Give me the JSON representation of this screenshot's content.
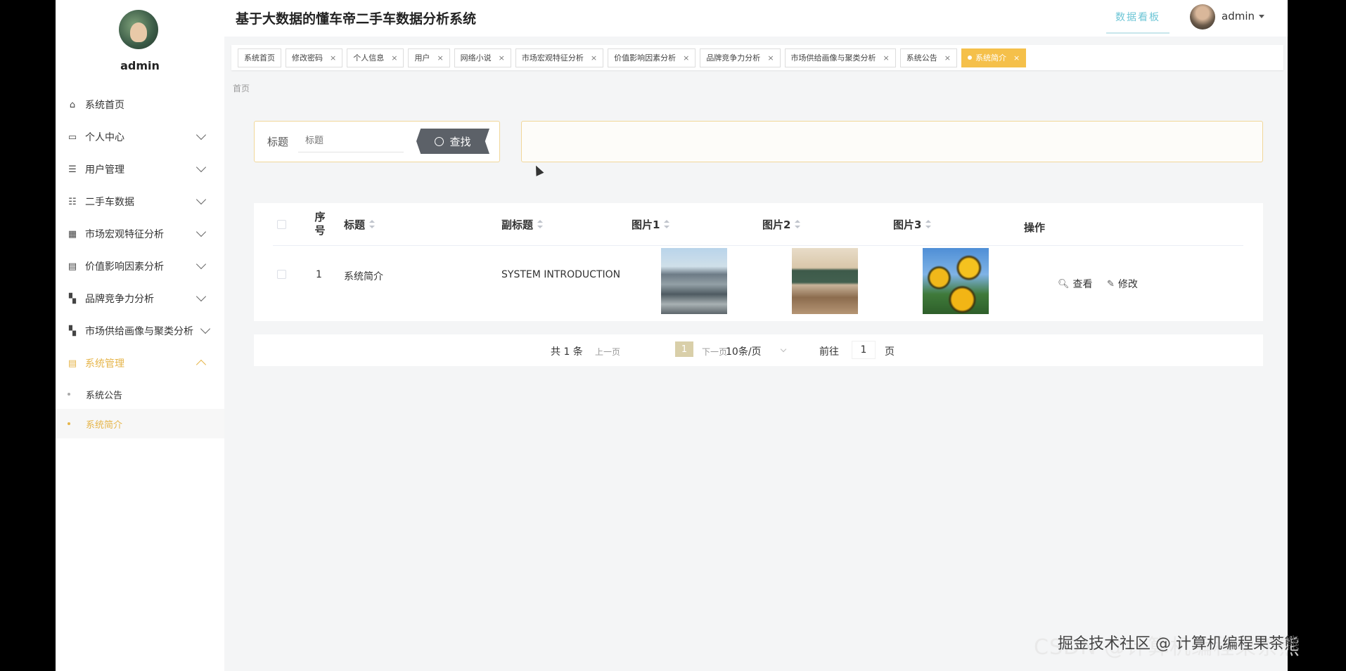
{
  "header": {
    "title": "基于大数据的懂车帝二手车数据分析系统",
    "dashboard_label": "数据看板",
    "username": "admin"
  },
  "sidebar": {
    "username": "admin",
    "items": [
      {
        "label": "系统首页",
        "icon": "home-icon"
      },
      {
        "label": "个人中心",
        "icon": "id-card-icon"
      },
      {
        "label": "用户管理",
        "icon": "list-icon"
      },
      {
        "label": "二手车数据",
        "icon": "sliders-icon"
      },
      {
        "label": "市场宏观特征分析",
        "icon": "grid-icon"
      },
      {
        "label": "价值影响因素分析",
        "icon": "clipboard-icon"
      },
      {
        "label": "品牌竞争力分析",
        "icon": "tiles-icon"
      },
      {
        "label": "市场供给画像与聚类分析",
        "icon": "tiles-icon"
      },
      {
        "label": "系统管理",
        "icon": "clipboard-icon"
      }
    ],
    "subitems": [
      {
        "label": "系统公告"
      },
      {
        "label": "系统简介"
      }
    ]
  },
  "tabs": [
    {
      "label": "系统首页",
      "closable": false
    },
    {
      "label": "修改密码",
      "closable": true
    },
    {
      "label": "个人信息",
      "closable": true
    },
    {
      "label": "用户",
      "closable": true
    },
    {
      "label": "网络小说",
      "closable": true
    },
    {
      "label": "市场宏观特征分析",
      "closable": true
    },
    {
      "label": "价值影响因素分析",
      "closable": true
    },
    {
      "label": "品牌竞争力分析",
      "closable": true
    },
    {
      "label": "市场供给画像与聚类分析",
      "closable": true
    },
    {
      "label": "系统公告",
      "closable": true
    },
    {
      "label": "系统简介",
      "closable": true,
      "active": true
    }
  ],
  "breadcrumb": "首页",
  "search": {
    "label": "标题",
    "placeholder": "标题",
    "button_label": "查找"
  },
  "table": {
    "columns": [
      "序号",
      "标题",
      "副标题",
      "图片1",
      "图片2",
      "图片3",
      "操作"
    ],
    "rows": [
      {
        "index": "1",
        "title": "系统简介",
        "subtitle": "SYSTEM INTRODUCTION",
        "view_label": "查看",
        "edit_label": "修改"
      }
    ]
  },
  "pager": {
    "total": "共 1 条",
    "prev": "上一页",
    "current": "1",
    "next": "下一页",
    "page_size": "10条/页",
    "goto_label": "前往",
    "goto_value": "1",
    "page_suffix": "页"
  },
  "watermark": "掘金技术社区 @ 计算机编程果茶熊",
  "watermark_back": "CSDN @计算机编程果茶熊",
  "colors": {
    "accent": "#f5c04a",
    "dashboard": "#6ec6d6",
    "active_menu": "#e6b54a"
  }
}
